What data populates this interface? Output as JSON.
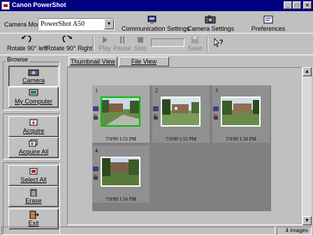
{
  "window": {
    "title": "Canon PowerShot"
  },
  "toolbar": {
    "camera_model_label": "Camera Model",
    "camera_model_value": "PowerShot A50",
    "communication_settings": "Communication Settings",
    "camera_settings": "Camera Settings",
    "preferences": "Preferences",
    "rotate_left": "Rotate 90° left",
    "rotate_right": "Rotate 90° Right",
    "play": "Play",
    "pause": "Pause",
    "stop": "Stop",
    "save": "Save"
  },
  "browse": {
    "title": "Browse",
    "camera": "Camera",
    "my_computer": "My Computer",
    "acquire": "Acquire",
    "acquire_all": "Acquire All",
    "select_all": "Select All",
    "erase": "Erase",
    "exit": "Exit"
  },
  "tabs": {
    "thumbnail_view": "Thumbnail View",
    "file_view": "File View"
  },
  "thumbnails": [
    {
      "num": "1",
      "date": "7/9/99 1:55 PM"
    },
    {
      "num": "2",
      "date": "7/9/99 1:55 PM"
    },
    {
      "num": "3",
      "date": "7/9/99 1:56 PM"
    },
    {
      "num": "4",
      "date": "7/9/99 1:56 PM"
    }
  ],
  "status": {
    "count": "4 images"
  },
  "colors": {
    "titlebar": "#000080",
    "selection": "#00c000",
    "face": "#c0c0c0"
  }
}
